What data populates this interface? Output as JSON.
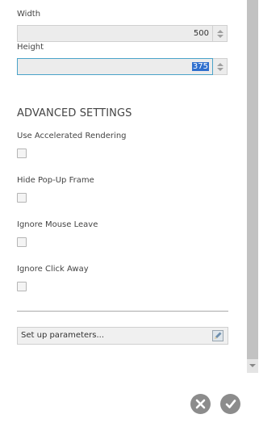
{
  "dimensions": {
    "width_label": "Width",
    "width_value": "500",
    "height_label": "Height",
    "height_value": "375"
  },
  "advanced": {
    "title": "ADVANCED SETTINGS",
    "options": [
      {
        "label": "Use Accelerated Rendering",
        "checked": false
      },
      {
        "label": "Hide Pop-Up Frame",
        "checked": false
      },
      {
        "label": "Ignore Mouse Leave",
        "checked": false
      },
      {
        "label": "Ignore Click Away",
        "checked": false
      }
    ]
  },
  "parameters": {
    "button_label": "Set up parameters...",
    "icon": "edit-pencil-icon"
  },
  "actions": {
    "cancel_icon": "close-icon",
    "confirm_icon": "checkmark-icon"
  },
  "colors": {
    "selection": "#2f6fce",
    "active_border": "#4aa3c9",
    "action_button": "#8c8c8c"
  }
}
